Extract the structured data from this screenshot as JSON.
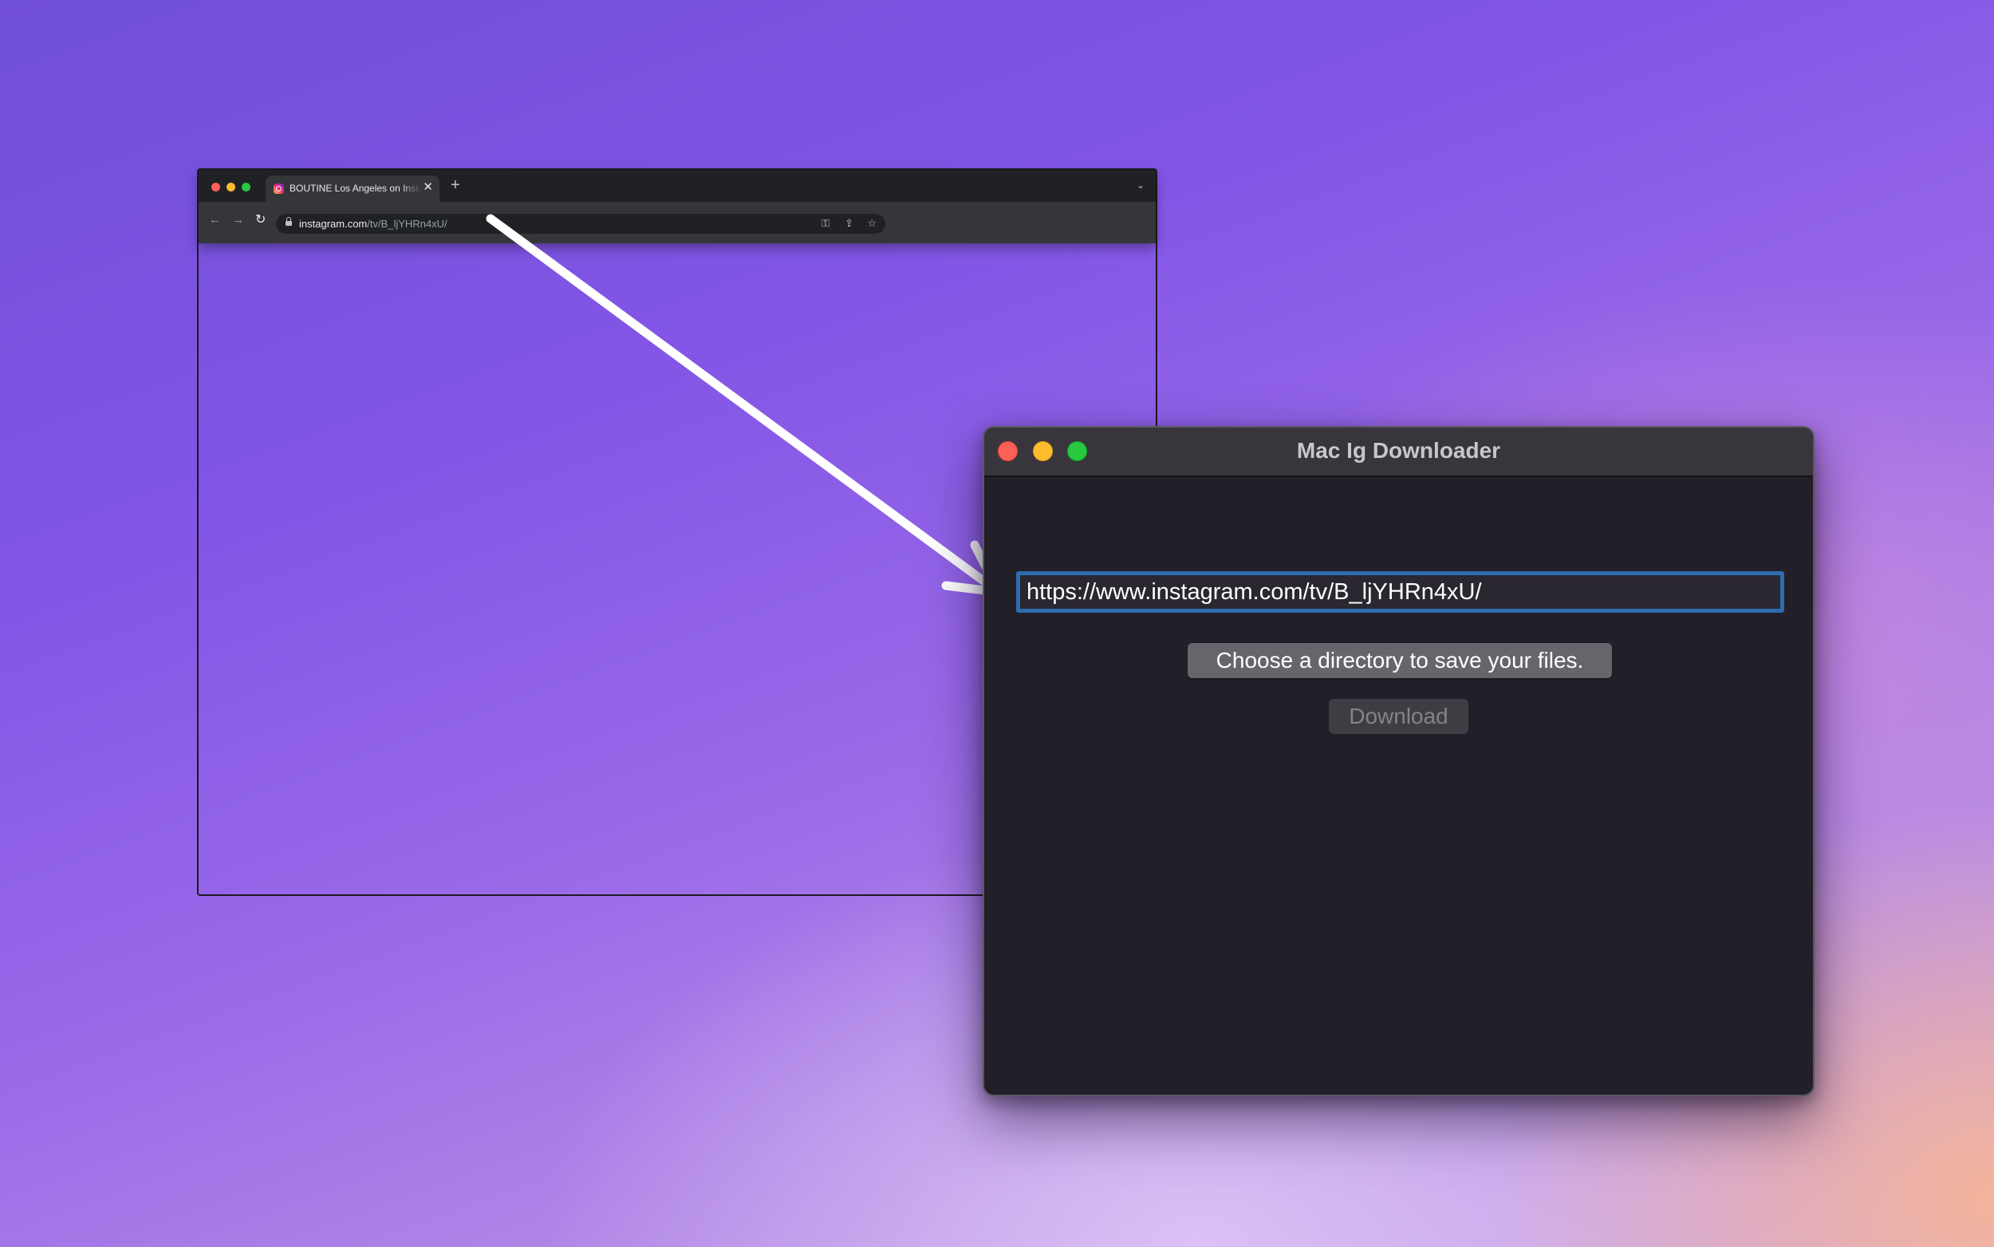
{
  "browser": {
    "tab": {
      "title": "BOUTINE Los Angeles on Instagram",
      "close_glyph": "✕"
    },
    "new_tab_glyph": "+",
    "tab_menu_glyph": "⌄",
    "nav": {
      "back_glyph": "←",
      "forward_glyph": "→",
      "reload_glyph": "↻"
    },
    "omnibox": {
      "url_domain": "instagram.com",
      "url_path": "/tv/B_ljYHRn4xU/",
      "key_glyph": "⚿",
      "share_glyph": "⇪",
      "star_glyph": "☆"
    }
  },
  "app": {
    "title": "Mac Ig Downloader",
    "url_input_value": "https://www.instagram.com/tv/B_ljYHRn4xU/",
    "choose_directory_label": "Choose a directory to save your files.",
    "download_label": "Download"
  },
  "colors": {
    "accent_focus": "#2f6bb0",
    "close": "#fe5f57",
    "minimize": "#febc2e",
    "zoom": "#28c840"
  }
}
